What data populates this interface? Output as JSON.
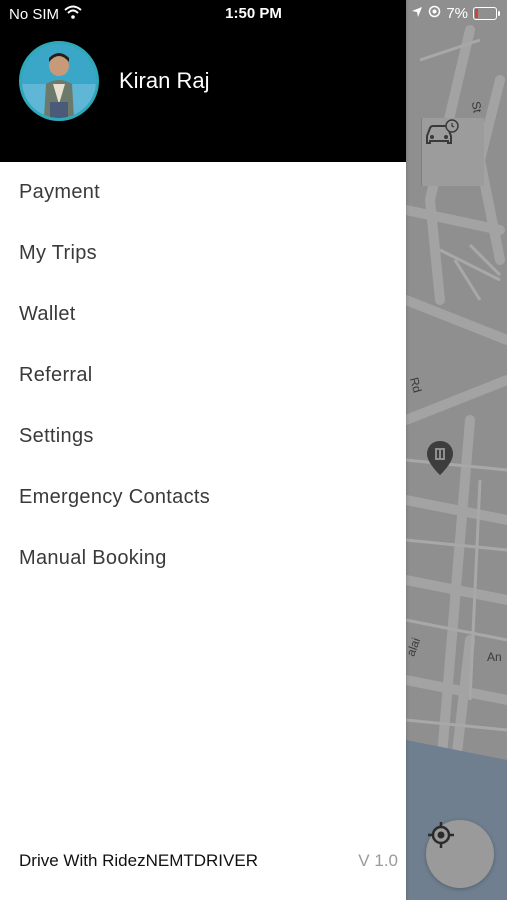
{
  "status_bar": {
    "carrier": "No SIM",
    "time": "1:50 PM",
    "battery": "7%"
  },
  "drawer": {
    "user_name": "Kiran Raj",
    "menu": [
      {
        "label": "Payment"
      },
      {
        "label": "My Trips"
      },
      {
        "label": "Wallet"
      },
      {
        "label": "Referral"
      },
      {
        "label": "Settings"
      },
      {
        "label": "Emergency Contacts"
      },
      {
        "label": "Manual Booking"
      }
    ],
    "footer_brand": "Drive With RidezNEMTDRIVER",
    "footer_version": "V 1.0"
  },
  "map": {
    "labels": [
      "St",
      "Rd",
      "alai",
      "An"
    ]
  },
  "colors": {
    "header_bg": "#000000",
    "avatar_ring": "#2fa9b7",
    "battery_low": "#e03b3b",
    "map_bg": "#8f8f8f"
  },
  "icons": [
    "wifi-icon",
    "location-arrow-icon",
    "alarm-icon",
    "battery-icon",
    "car-clock-icon",
    "map-pin-icon",
    "locate-me-icon"
  ]
}
